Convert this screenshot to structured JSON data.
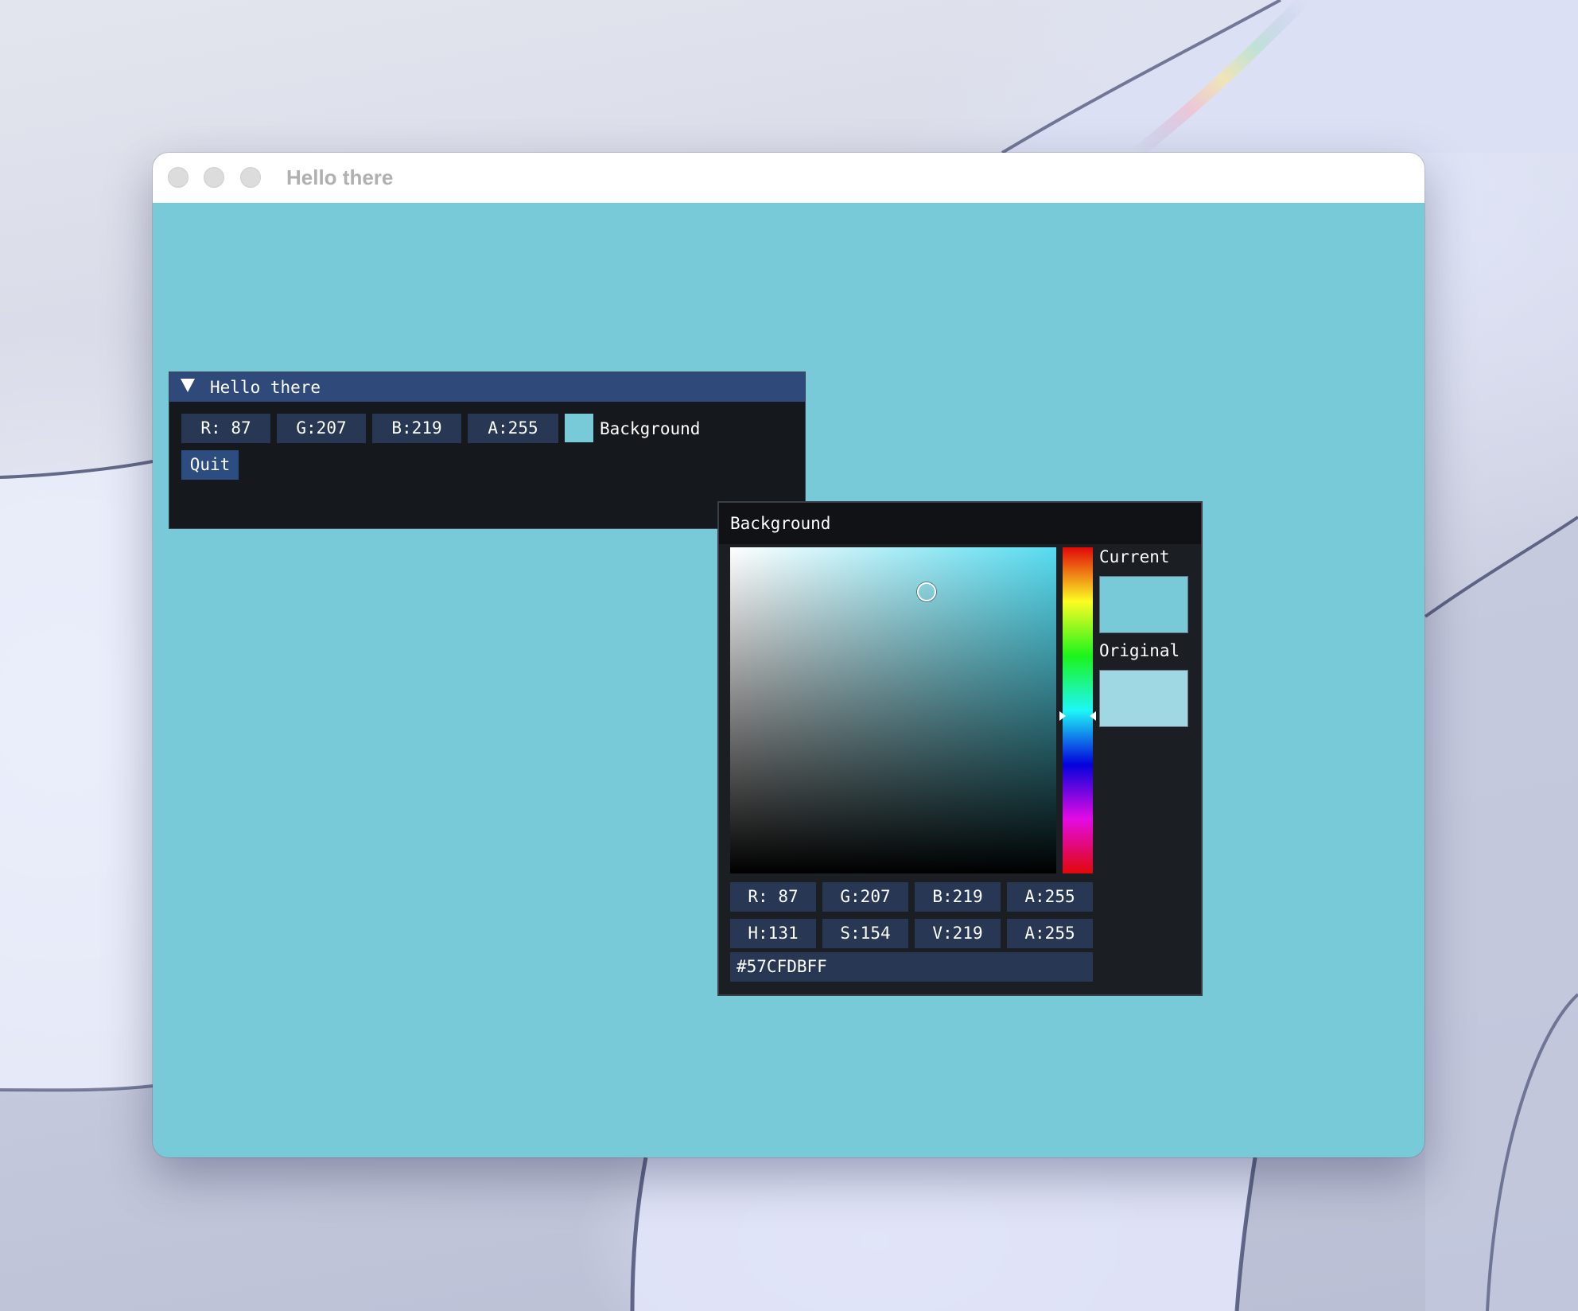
{
  "window": {
    "title": "Hello there"
  },
  "imgui_window": {
    "title": "Hello there",
    "fields": {
      "r": "R: 87",
      "g": "G:207",
      "b": "B:219",
      "a": "A:255"
    },
    "color_label": "Background",
    "quit_label": "Quit"
  },
  "color_picker": {
    "title": "Background",
    "current_label": "Current",
    "original_label": "Original",
    "rgba": {
      "r": "R: 87",
      "g": "G:207",
      "b": "B:219",
      "a": "A:255"
    },
    "hsva": {
      "h": "H:131",
      "s": "S:154",
      "v": "V:219",
      "a": "A:255"
    },
    "hex": "#57CFDBFF"
  },
  "colors": {
    "background": "#78cad9",
    "current": "#78cad9",
    "original": "#9fd8e2",
    "imgui_title_bar": "#2f4a7a",
    "imgui_window_bg": "#15181c",
    "field_bg": "#273754",
    "button_bg": "#2d4d80"
  },
  "icons": {
    "collapse": "triangle-down-icon",
    "traffic_lights": [
      "close-button",
      "minimize-button",
      "zoom-button"
    ]
  }
}
